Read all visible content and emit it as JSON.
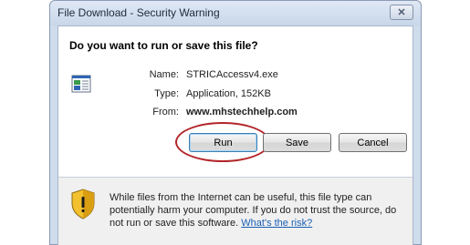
{
  "window": {
    "title": "File Download - Security Warning",
    "close_glyph": "✕"
  },
  "dialog": {
    "question": "Do you want to run or save this file?",
    "file": {
      "name_label": "Name:",
      "name_value": "STRICAccessv4.exe",
      "type_label": "Type:",
      "type_value": "Application, 152KB",
      "from_label": "From:",
      "from_value": "www.mhstechhelp.com",
      "icon": "application-file-icon"
    },
    "buttons": {
      "run": "Run",
      "save": "Save",
      "cancel": "Cancel"
    },
    "warning": {
      "text": "While files from the Internet can be useful, this file type can potentially harm your computer. If you do not trust the source, do not run or save this software.",
      "link": "What's the risk?",
      "icon": "security-shield-warning-icon"
    }
  },
  "colors": {
    "annotation_oval": "#b3262b",
    "link": "#1a5fb4"
  }
}
